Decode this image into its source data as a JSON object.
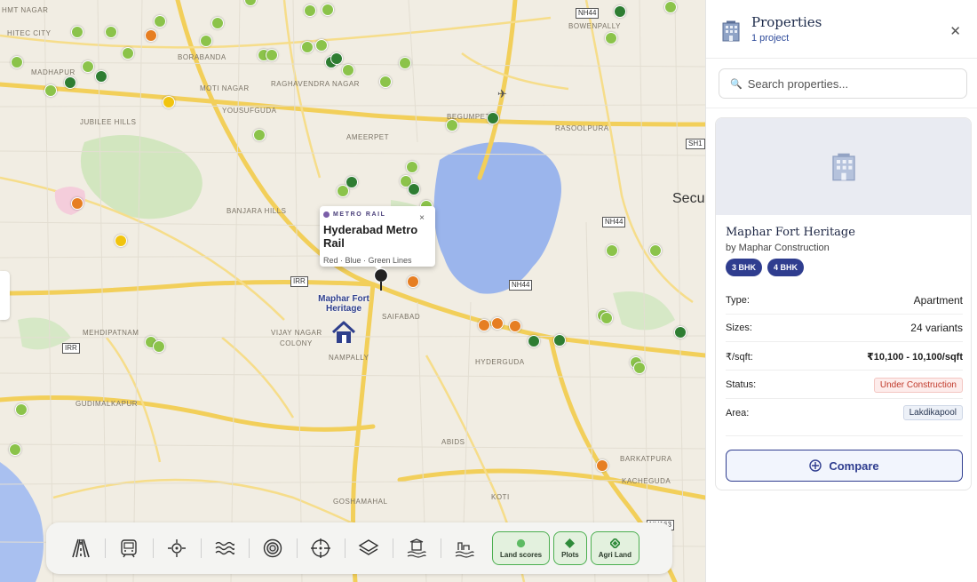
{
  "map": {
    "road_labels": [
      "HITEC CITY",
      "MADHAPUR",
      "JUBILEE HILLS",
      "BANJARA HILLS",
      "MEHDIPATNAM",
      "GUDIMALKAPUR",
      "VIJAY NAGAR",
      "COLONY",
      "NAMPALLY",
      "SAIFABAD",
      "HYDERGUDA",
      "ABIDS",
      "KOTI",
      "GOSHAMAHAL",
      "BARKATPURA",
      "KACHEGUDA",
      "AMEERPET",
      "BEGUMPET",
      "RASOOLPURA",
      "BOWENPALLY",
      "YOUSUFGUDA",
      "MOTI NAGAR",
      "BORABANDA",
      "RAGHAVENDRA NAGAR",
      "HMT NAGAR"
    ],
    "highway_labels": [
      "NH44",
      "NH44",
      "NH44",
      "NH163",
      "SH1",
      "IRR",
      "IRR"
    ],
    "city_label": "Secun",
    "markers_colors": {
      "green": "#8bc34a",
      "dark_green": "#2e7d32",
      "orange": "#e67e22",
      "yellow": "#f1c40f"
    },
    "metro_popup": {
      "badge": "METRO RAIL",
      "close": "×",
      "title": "Hyderabad Metro Rail",
      "lines": "Red · Blue · Green Lines"
    },
    "project_pin": {
      "line1": "Maphar Fort",
      "line2": "Heritage"
    }
  },
  "toolbar": {
    "tools": [
      {
        "icon": "road-icon"
      },
      {
        "icon": "metro-train-icon"
      },
      {
        "icon": "location-crosshair-icon"
      },
      {
        "icon": "water-waves-icon"
      },
      {
        "icon": "ring-road-icon"
      },
      {
        "icon": "target-icon"
      },
      {
        "icon": "layers-icon"
      },
      {
        "icon": "lake-building-icon"
      },
      {
        "icon": "factory-icon"
      }
    ],
    "layers": [
      {
        "label": "Land scores",
        "icon": "circle-icon"
      },
      {
        "label": "Plots",
        "icon": "diamond-icon"
      },
      {
        "label": "Agri Land",
        "icon": "diamond-outline-icon"
      }
    ]
  },
  "panel": {
    "title": "Properties",
    "subtitle": "1 project",
    "close": "✕",
    "search": {
      "placeholder": "Search properties...",
      "value": ""
    },
    "card": {
      "name": "Maphar Fort Heritage",
      "builder": "by Maphar Construction",
      "tags": [
        "3 BHK",
        "4 BHK"
      ],
      "details": [
        {
          "key": "Type:",
          "value": "Apartment"
        },
        {
          "key": "Sizes:",
          "value": "24 variants"
        },
        {
          "key": "₹/sqft:",
          "value": "₹10,100 - 10,100/sqft"
        },
        {
          "key": "Status:",
          "value": "Under Construction"
        },
        {
          "key": "Area:",
          "value": "Lakdikapool"
        }
      ],
      "compare_label": "Compare"
    }
  }
}
